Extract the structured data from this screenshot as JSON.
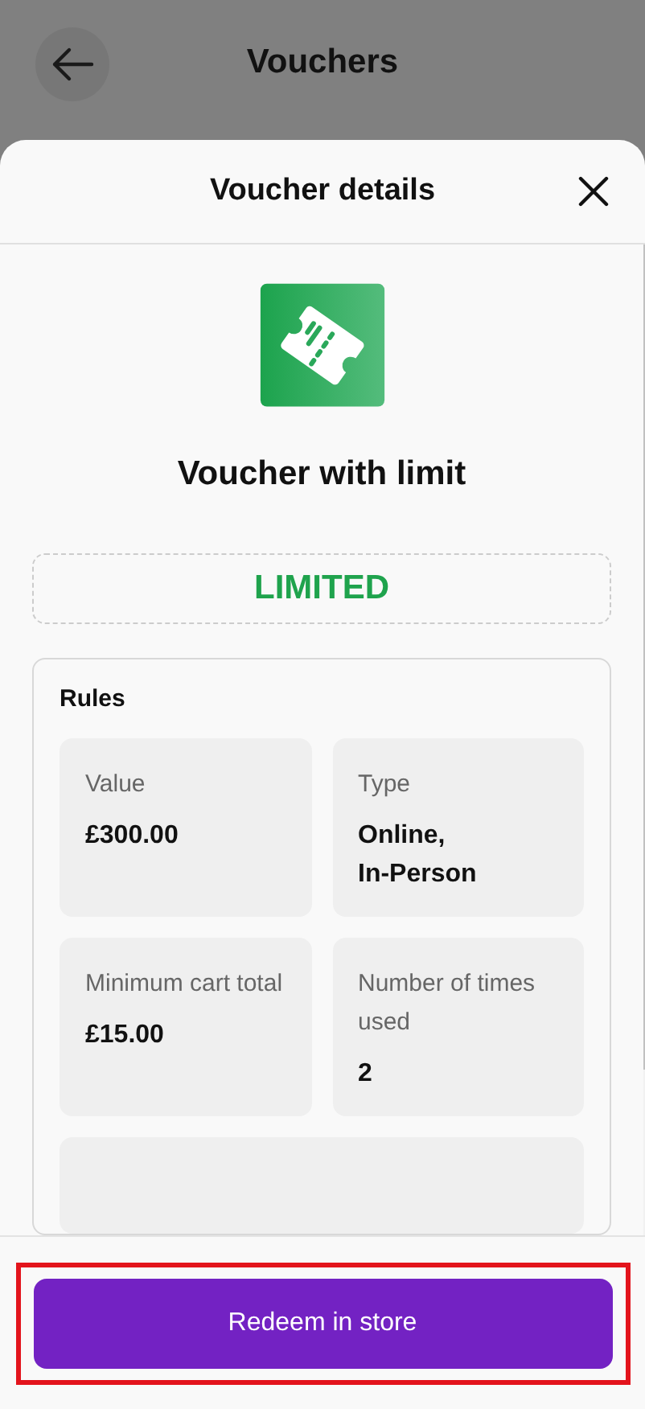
{
  "page_header": {
    "title": "Vouchers"
  },
  "sheet": {
    "title": "Voucher details"
  },
  "voucher": {
    "name": "Voucher with limit",
    "status": "LIMITED"
  },
  "rules": {
    "title": "Rules",
    "items": [
      {
        "label": "Value",
        "value": "£300.00"
      },
      {
        "label": "Type",
        "value": "Online,\nIn-Person"
      },
      {
        "label": "Minimum cart total",
        "value": "£15.00"
      },
      {
        "label": "Number of times used",
        "value": "2"
      }
    ]
  },
  "footer": {
    "button": "Redeem in store",
    "highlighted": true
  }
}
